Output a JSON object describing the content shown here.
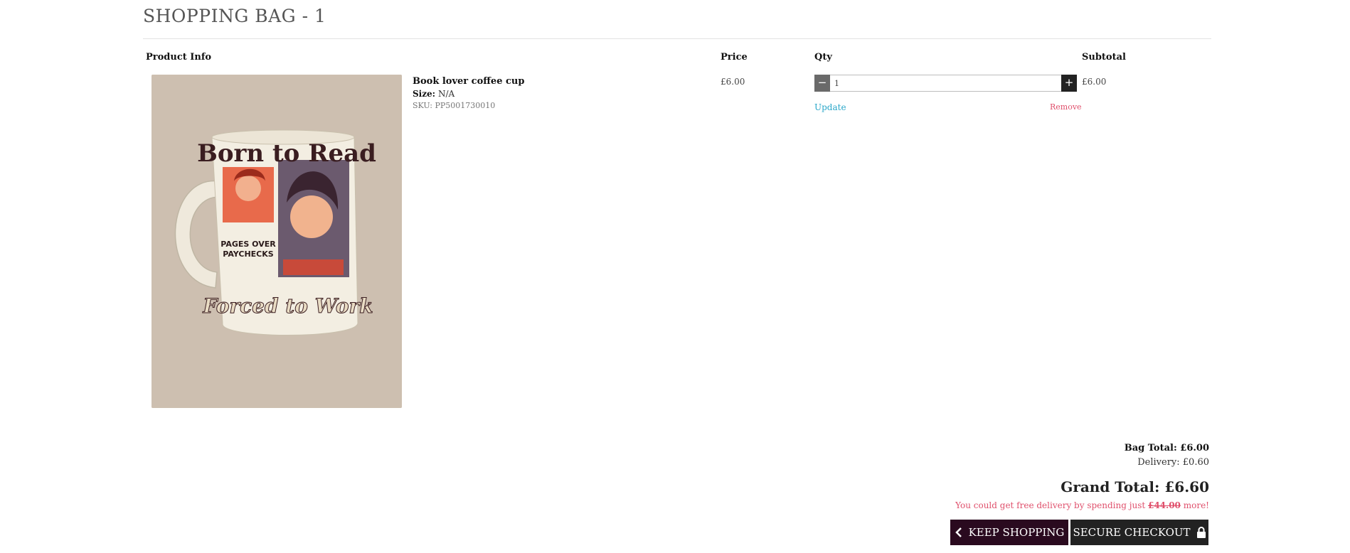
{
  "header": {
    "title": "SHOPPING BAG - 1"
  },
  "columns": {
    "product": "Product Info",
    "price": "Price",
    "qty": "Qty",
    "subtotal": "Subtotal"
  },
  "item": {
    "name": "Book lover coffee cup",
    "size_label": "Size:",
    "size_value": "N/A",
    "sku": "SKU: PP5001730010",
    "price": "£6.00",
    "qty": "1",
    "subtotal": "£6.00",
    "update_label": "Update",
    "remove_label": "Remove",
    "image_text": {
      "line1": "Born to Read",
      "line2": "PAGES OVER",
      "line3": "PAYCHECKS",
      "line4": "Forced to Work"
    }
  },
  "totals": {
    "bag_total": "Bag Total: £6.00",
    "delivery": "Delivery: £0.60",
    "grand_total": "Grand Total: £6.60",
    "free_prefix": "You could get free delivery by spending just ",
    "free_amount": "£44.00",
    "free_suffix": " more!"
  },
  "actions": {
    "keep_shopping": "KEEP SHOPPING",
    "secure_checkout": "SECURE CHECKOUT"
  },
  "colors": {
    "accent_blue": "#2aa7c9",
    "accent_red": "#e0506c",
    "keep_btn": "#2a0a1f",
    "checkout_btn": "#222222",
    "image_bg": "#cdbfb0"
  },
  "icons": {
    "minus": "minus-icon",
    "plus": "plus-icon",
    "back": "chevron-left-icon",
    "lock": "lock-icon"
  }
}
